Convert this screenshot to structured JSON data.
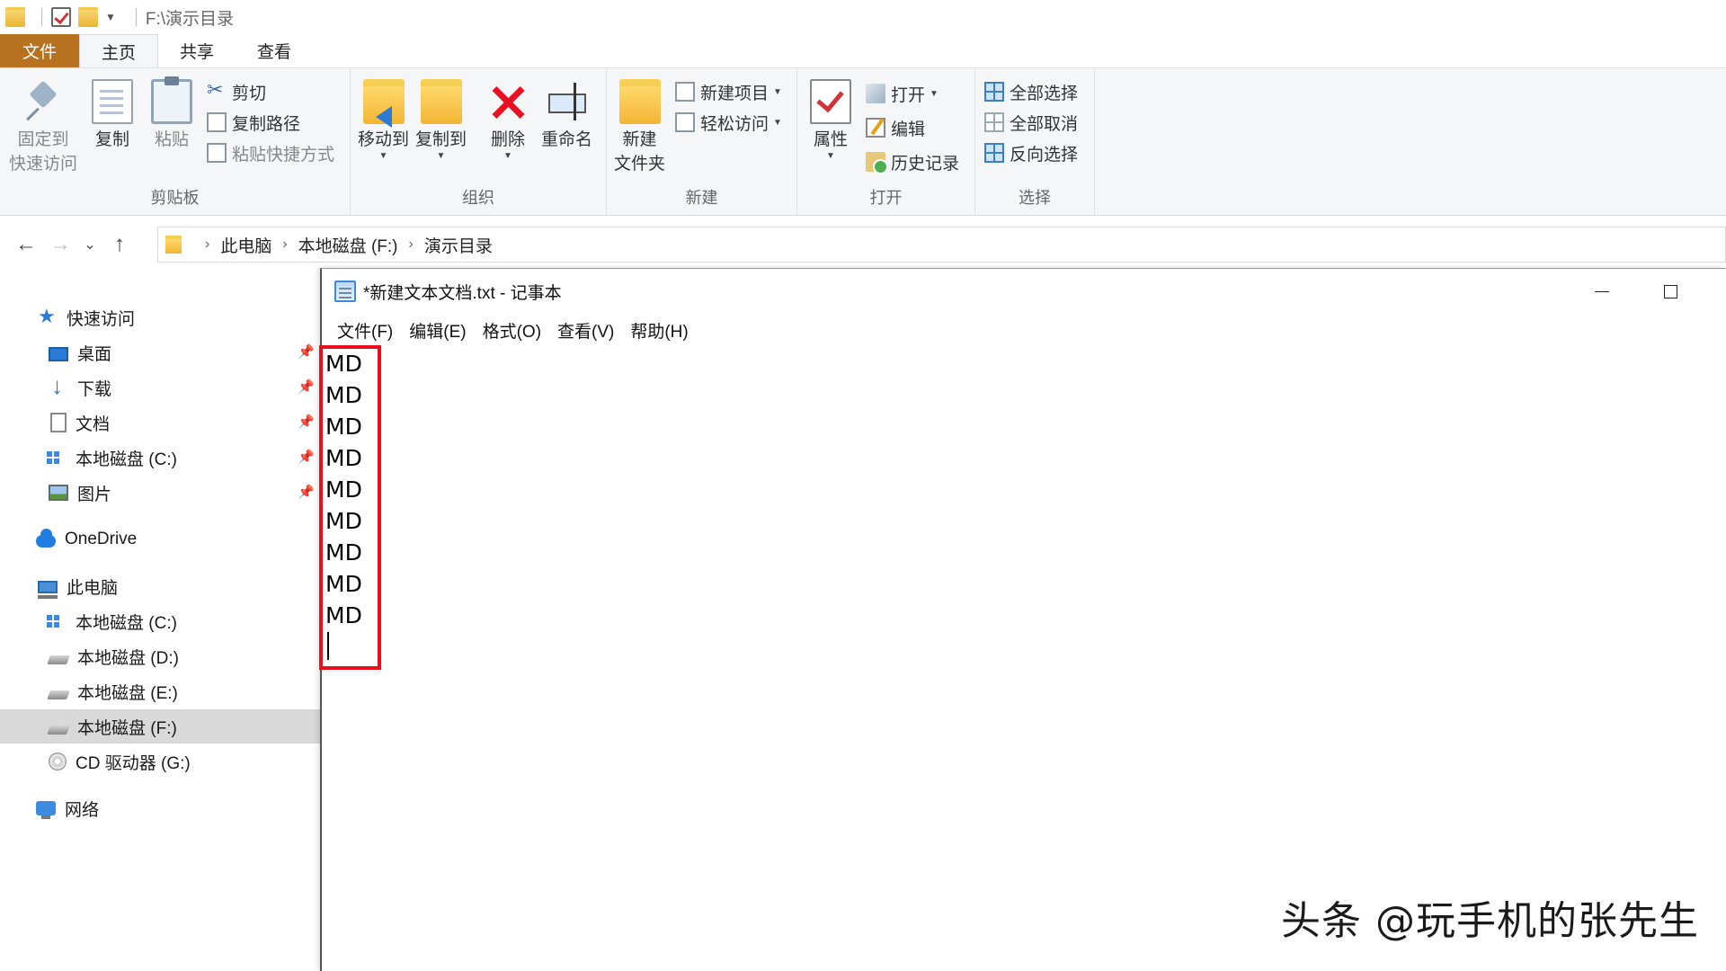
{
  "window": {
    "title_path": "F:\\演示目录"
  },
  "ribbon_tabs": [
    "文件",
    "主页",
    "共享",
    "查看"
  ],
  "ribbon": {
    "clipboard": {
      "label": "剪贴板",
      "pin_label_1": "固定到",
      "pin_label_2": "快速访问",
      "copy": "复制",
      "paste": "粘贴",
      "cut": "剪切",
      "copy_path": "复制路径",
      "paste_shortcut": "粘贴快捷方式"
    },
    "organize": {
      "label": "组织",
      "move_to": "移动到",
      "copy_to": "复制到",
      "delete": "删除",
      "rename": "重命名"
    },
    "new": {
      "label": "新建",
      "new_folder_1": "新建",
      "new_folder_2": "文件夹",
      "new_item": "新建项目",
      "easy_access": "轻松访问"
    },
    "open": {
      "label": "打开",
      "properties": "属性",
      "open": "打开",
      "edit": "编辑",
      "history": "历史记录"
    },
    "select": {
      "label": "选择",
      "select_all": "全部选择",
      "select_none": "全部取消",
      "invert": "反向选择"
    }
  },
  "address": {
    "crumbs": [
      "此电脑",
      "本地磁盘 (F:)",
      "演示目录"
    ]
  },
  "nav": {
    "quick_access": "快速访问",
    "desktop": "桌面",
    "downloads": "下载",
    "documents": "文档",
    "local_c_qa": "本地磁盘 (C:)",
    "pictures": "图片",
    "onedrive": "OneDrive",
    "this_pc": "此电脑",
    "local_c": "本地磁盘 (C:)",
    "local_d": "本地磁盘 (D:)",
    "local_e": "本地磁盘 (E:)",
    "local_f": "本地磁盘 (F:)",
    "cd_g": "CD 驱动器 (G:)",
    "network": "网络"
  },
  "notepad": {
    "title": "*新建文本文档.txt - 记事本",
    "menu": [
      "文件(F)",
      "编辑(E)",
      "格式(O)",
      "查看(V)",
      "帮助(H)"
    ],
    "lines": [
      "MD",
      "MD",
      "MD",
      "MD",
      "MD",
      "MD",
      "MD",
      "MD",
      "MD"
    ]
  },
  "watermark": "头条 @玩手机的张先生",
  "colors": {
    "file_tab": "#b8711e",
    "highlight_box": "#e8101c",
    "selected_nav": "#d9d9d9"
  }
}
